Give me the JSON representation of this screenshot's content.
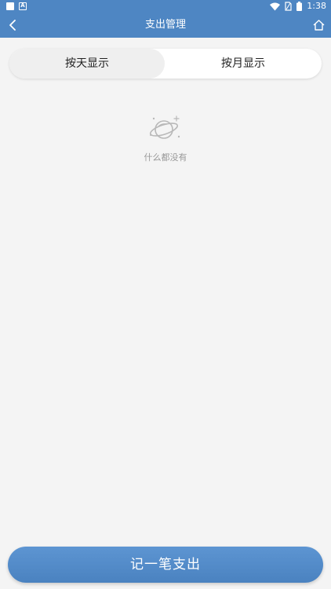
{
  "status_bar": {
    "time": "1:38",
    "icons": [
      "notification-square-icon",
      "a-badge-icon",
      "wifi-icon",
      "sim-disabled-icon",
      "battery-icon"
    ]
  },
  "header": {
    "title": "支出管理",
    "back_icon": "back-arrow-icon",
    "home_icon": "home-icon"
  },
  "tabs": [
    {
      "label": "按天显示",
      "selected": true
    },
    {
      "label": "按月显示",
      "selected": false
    }
  ],
  "empty_state": {
    "icon": "planet-icon",
    "text": "什么都没有"
  },
  "actions": {
    "add_expense_label": "记一笔支出"
  },
  "colors": {
    "primary": "#4e86c3",
    "background": "#f4f4f4",
    "muted_text": "#999999"
  }
}
